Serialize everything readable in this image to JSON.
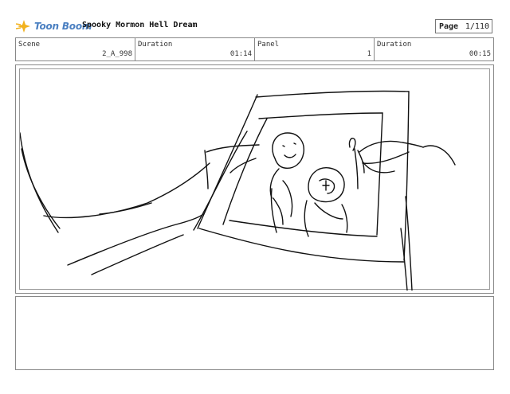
{
  "header": {
    "logo_text": "Toon Boom",
    "title": "Spooky Mormon Hell Dream",
    "page_label": "Page",
    "page_value": "1/110"
  },
  "info": {
    "scene_label": "Scene",
    "scene_value": "2_A_998",
    "scene_duration_label": "Duration",
    "scene_duration_value": "01:14",
    "panel_label": "Panel",
    "panel_value": "1",
    "panel_duration_label": "Duration",
    "panel_duration_value": "00:15"
  },
  "notes": {
    "text": ""
  }
}
